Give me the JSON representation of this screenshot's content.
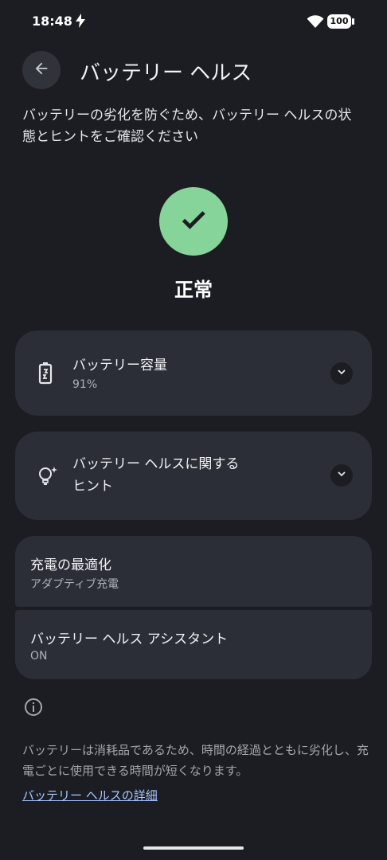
{
  "status_bar": {
    "time": "18:48",
    "battery": "100"
  },
  "header": {
    "title": "バッテリー ヘルス"
  },
  "intro": "バッテリーの劣化を防ぐため、バッテリー ヘルスの状態とヒントをご確認ください",
  "health_status": {
    "label": "正常",
    "color": "#86d49a"
  },
  "cards": {
    "capacity": {
      "title": "バッテリー容量",
      "value": "91%"
    },
    "tips": {
      "title_line1": "バッテリー ヘルスに関する",
      "title_line2": "ヒント"
    }
  },
  "settings": {
    "optimize": {
      "title": "充電の最適化",
      "subtitle": "アダプティブ充電"
    },
    "assistant": {
      "title": "バッテリー ヘルス アシスタント",
      "subtitle": "ON"
    }
  },
  "footer": {
    "text": "バッテリーは消耗品であるため、時間の経過とともに劣化し、充電ごとに使用できる時間が短くなります。",
    "link": "バッテリー ヘルスの詳細"
  },
  "colors": {
    "background": "#1b1d22",
    "card": "#2b2e36",
    "link": "#a9c7ff"
  }
}
